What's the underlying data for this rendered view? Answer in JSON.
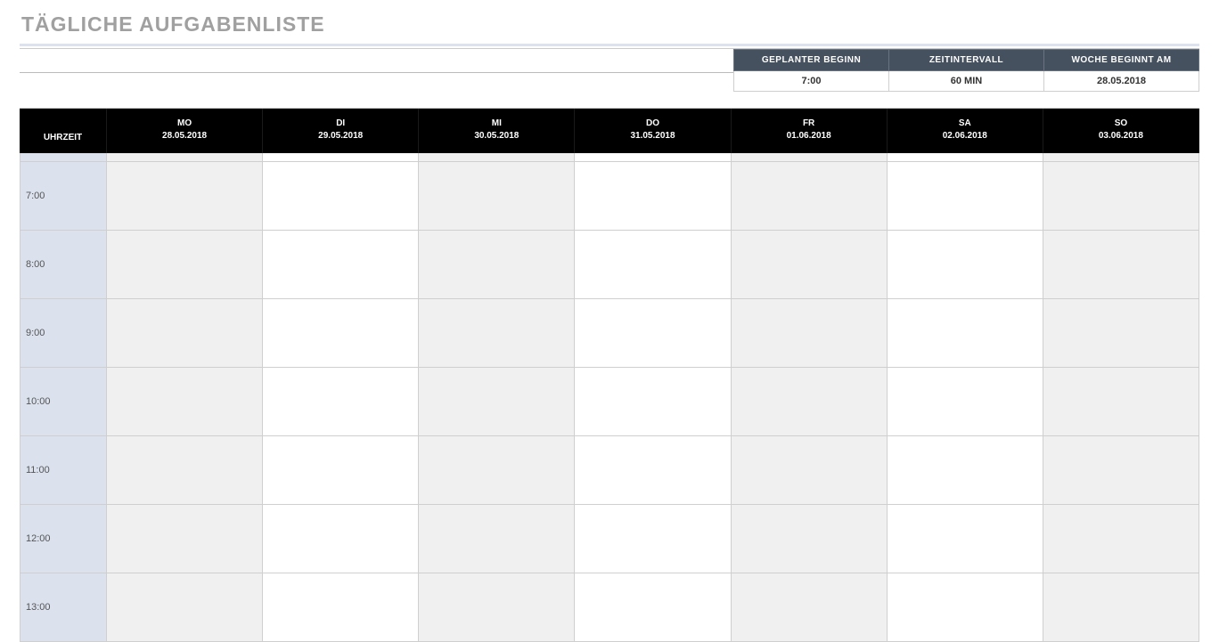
{
  "title": "TÄGLICHE AUFGABENLISTE",
  "meta": {
    "headers": {
      "start": "GEPLANTER BEGINN",
      "interval": "ZEITINTERVALL",
      "weekStart": "WOCHE BEGINNT AM"
    },
    "values": {
      "start": "7:00",
      "interval": "60 MIN",
      "weekStart": "28.05.2018"
    }
  },
  "schedule": {
    "timeHeader": "UHRZEIT",
    "days": [
      {
        "abbr": "MO",
        "date": "28.05.2018"
      },
      {
        "abbr": "DI",
        "date": "29.05.2018"
      },
      {
        "abbr": "MI",
        "date": "30.05.2018"
      },
      {
        "abbr": "DO",
        "date": "31.05.2018"
      },
      {
        "abbr": "FR",
        "date": "01.06.2018"
      },
      {
        "abbr": "SA",
        "date": "02.06.2018"
      },
      {
        "abbr": "SO",
        "date": "03.06.2018"
      }
    ],
    "times": [
      "7:00",
      "8:00",
      "9:00",
      "10:00",
      "11:00",
      "12:00",
      "13:00"
    ]
  }
}
